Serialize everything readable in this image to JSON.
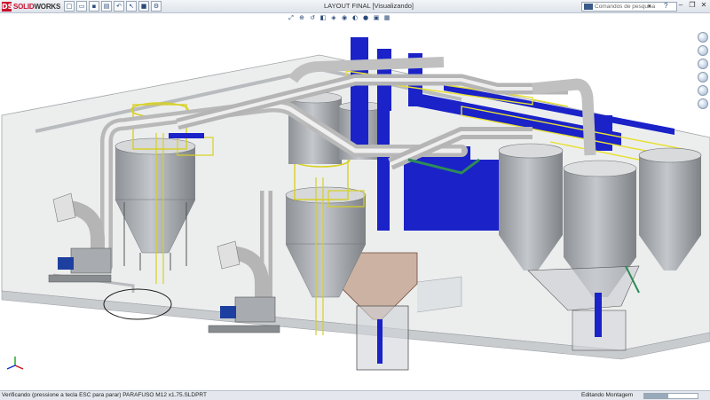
{
  "app": {
    "logo_solid": "SOLID",
    "logo_works": "WORKS"
  },
  "quick_access": [
    "new-icon",
    "open-icon",
    "save-icon",
    "print-icon",
    "undo-icon",
    "select-icon",
    "rebuild-icon",
    "options-icon"
  ],
  "document": {
    "title": "LAYOUT FINAL [Visualizando]"
  },
  "search": {
    "placeholder": "Comandos de pesquisa"
  },
  "view_toolbar": [
    "zoom-to-fit-icon",
    "zoom-area-icon",
    "previous-view-icon",
    "section-view-icon",
    "view-orientation-icon",
    "display-style-icon",
    "hide-show-icon",
    "edit-appearance-icon",
    "scene-icon",
    "view-settings-icon"
  ],
  "task_pane": [
    "resources-icon",
    "design-library-icon",
    "file-explorer-icon",
    "view-palette-icon",
    "appearances-icon",
    "custom-properties-icon"
  ],
  "status": {
    "message": "Verificando (pressione a tecla ESC para parar) PARAFUSO M12 x1.75.SLDPRT",
    "mode": "Editando Montagem",
    "progress": 0.45
  },
  "colors": {
    "structure_blue": "#1a22c8",
    "silo_gray": "#a8acb0",
    "rail_yellow": "#e8e030",
    "floor": "#eceeee"
  }
}
